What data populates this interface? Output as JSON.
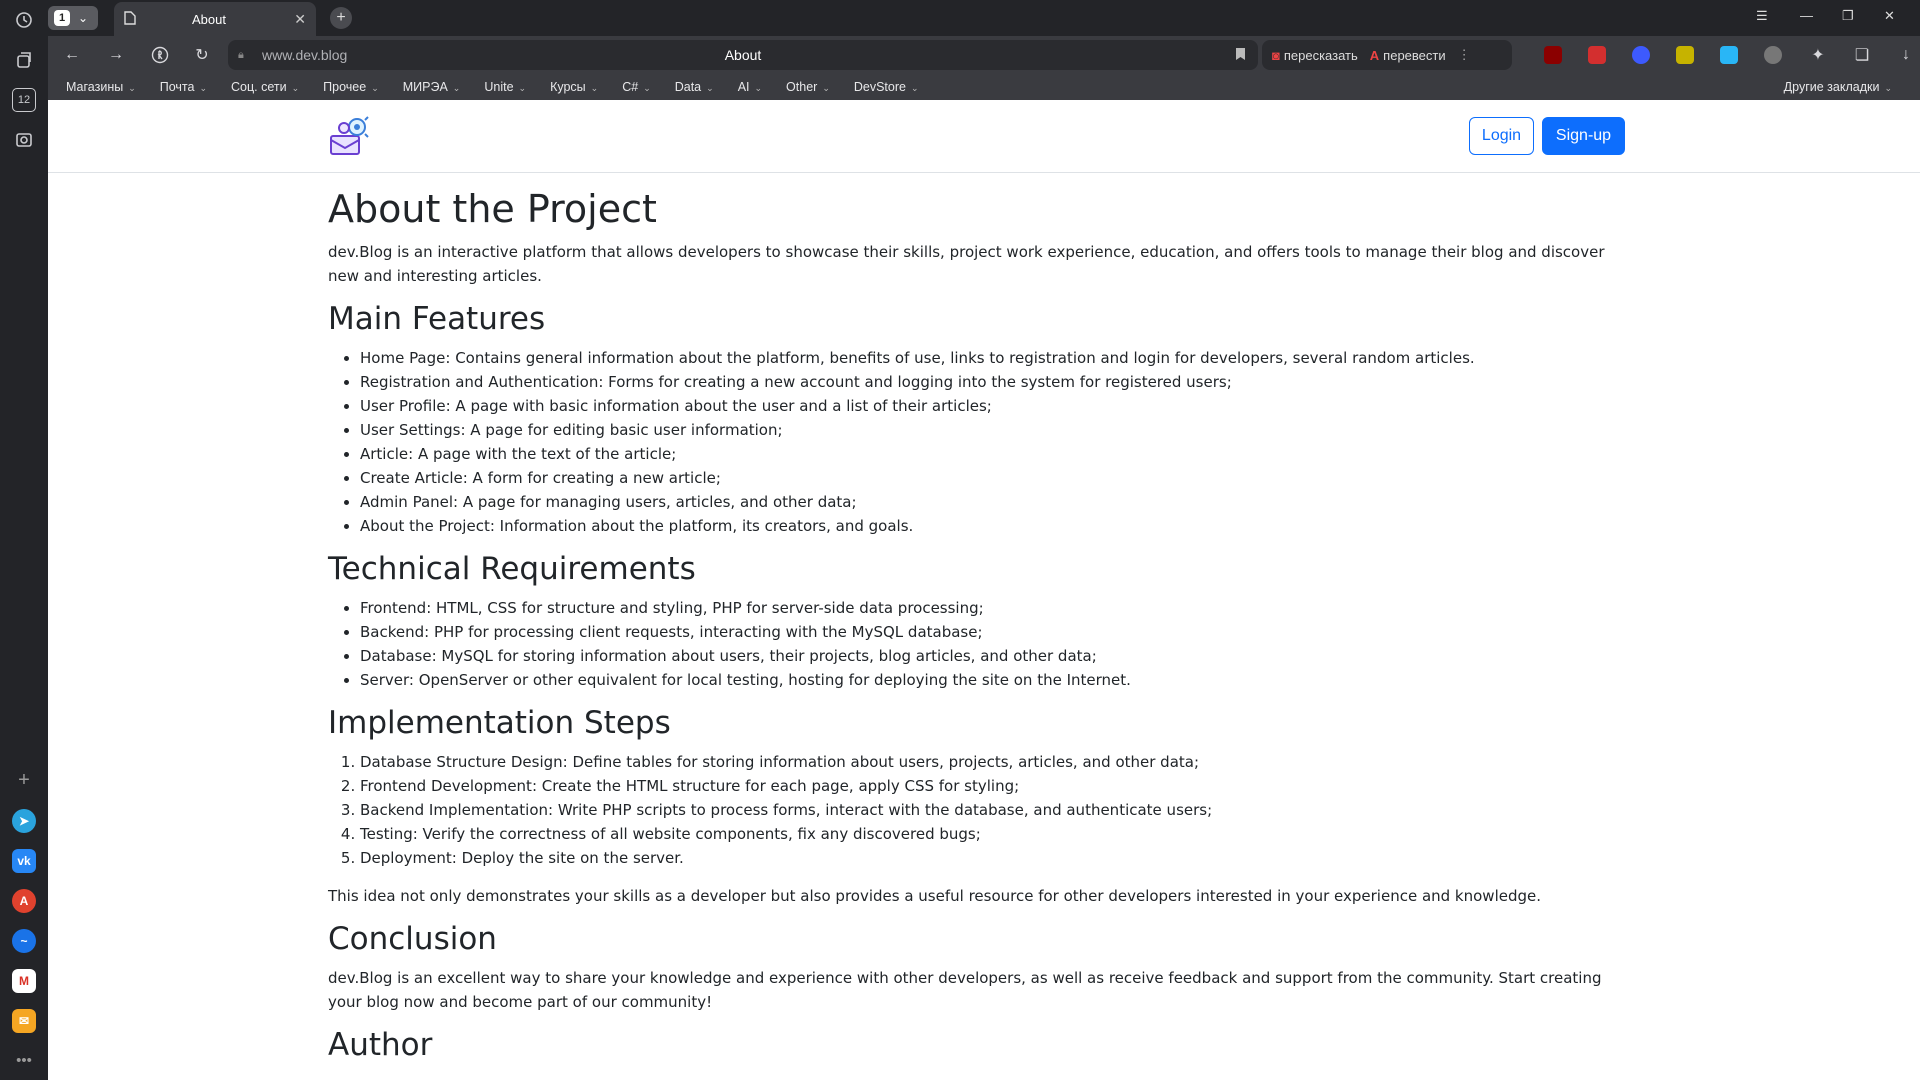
{
  "browser": {
    "tab_count": "1",
    "tab_title": "About",
    "url": "www.dev.blog",
    "page_title": "About",
    "ai_actions": [
      "пересказать",
      "перевести"
    ],
    "bookmarks": [
      "Магазины",
      "Почта",
      "Соц. сети",
      "Прочее",
      "МИРЭА",
      "Unite",
      "Курсы",
      "C#",
      "Data",
      "AI",
      "Other",
      "DevStore"
    ],
    "other_bookmarks": "Другие закладки",
    "sidebar_badge": "12"
  },
  "header": {
    "login_label": "Login",
    "signup_label": "Sign-up"
  },
  "content": {
    "title": "About the Project",
    "intro": "dev.Blog is an interactive platform that allows developers to showcase their skills, project work experience, education, and offers tools to manage their blog and discover new and interesting articles.",
    "features_heading": "Main Features",
    "features": [
      "Home Page: Contains general information about the platform, benefits of use, links to registration and login for developers, several random articles.",
      "Registration and Authentication: Forms for creating a new account and logging into the system for registered users;",
      "User Profile: A page with basic information about the user and a list of their articles;",
      "User Settings: A page for editing basic user information;",
      "Article: A page with the text of the article;",
      "Create Article: A form for creating a new article;",
      "Admin Panel: A page for managing users, articles, and other data;",
      "About the Project: Information about the platform, its creators, and goals."
    ],
    "tech_heading": "Technical Requirements",
    "tech": [
      "Frontend: HTML, CSS for structure and styling, PHP for server-side data processing;",
      "Backend: PHP for processing client requests, interacting with the MySQL database;",
      "Database: MySQL for storing information about users, their projects, blog articles, and other data;",
      "Server: OpenServer or other equivalent for local testing, hosting for deploying the site on the Internet."
    ],
    "steps_heading": "Implementation Steps",
    "steps": [
      "Database Structure Design: Define tables for storing information about users, projects, articles, and other data;",
      "Frontend Development: Create the HTML structure for each page, apply CSS for styling;",
      "Backend Implementation: Write PHP scripts to process forms, interact with the database, and authenticate users;",
      "Testing: Verify the correctness of all website components, fix any discovered bugs;",
      "Deployment: Deploy the site on the server."
    ],
    "idea_text": "This idea not only demonstrates your skills as a developer but also provides a useful resource for other developers interested in your experience and knowledge.",
    "conclusion_heading": "Conclusion",
    "conclusion_text": "dev.Blog is an excellent way to share your knowledge and experience with other developers, as well as receive feedback and support from the community. Start creating your blog now and become part of our community!",
    "author_heading": "Author"
  },
  "colors": {
    "primary": "#0d6efd",
    "browser_dark": "#232428",
    "toolbar": "#3a3b40"
  }
}
